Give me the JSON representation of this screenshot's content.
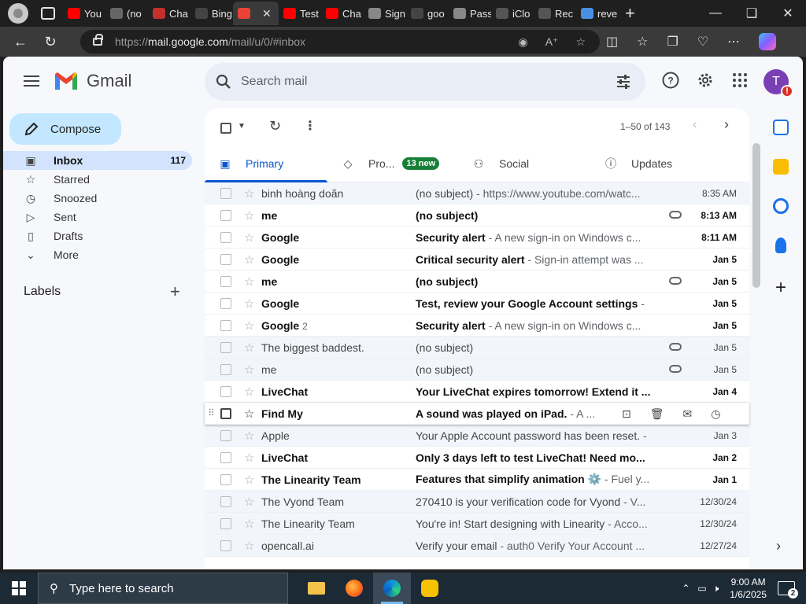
{
  "browser": {
    "tabs": [
      {
        "label": "You",
        "icon": "youtube-icon",
        "color": "#ff0000"
      },
      {
        "label": "(no",
        "icon": "gmail-icon",
        "color": "#666666"
      },
      {
        "label": "Cha",
        "icon": "youtube-icon",
        "color": "#c4302b"
      },
      {
        "label": "Bing",
        "icon": "search-icon",
        "color": "#444444"
      },
      {
        "label": "",
        "icon": "gmail-icon",
        "color": "#ea4335",
        "active": true
      },
      {
        "label": "Test",
        "icon": "youtube-icon",
        "color": "#ff0000"
      },
      {
        "label": "Cha",
        "icon": "youtube-icon",
        "color": "#ff0000"
      },
      {
        "label": "Sign",
        "icon": "google-icon",
        "color": "#888888"
      },
      {
        "label": "goo",
        "icon": "search-icon",
        "color": "#444444"
      },
      {
        "label": "Pass",
        "icon": "google-icon",
        "color": "#888888"
      },
      {
        "label": "iClo",
        "icon": "apple-icon",
        "color": "#555555"
      },
      {
        "label": "Rec",
        "icon": "apple-icon",
        "color": "#555555"
      },
      {
        "label": "reve",
        "icon": "search-icon",
        "color": "#4a90e2"
      }
    ],
    "url_prefix": "https://",
    "url_host": "mail.google.com",
    "url_path": "/mail/u/0/#inbox"
  },
  "gmail": {
    "logo_text": "Gmail",
    "search_placeholder": "Search mail",
    "avatar_letter": "T",
    "compose_label": "Compose",
    "nav": [
      {
        "label": "Inbox",
        "icon": "inbox-icon",
        "count": "117",
        "active": true
      },
      {
        "label": "Starred",
        "icon": "star-icon"
      },
      {
        "label": "Snoozed",
        "icon": "clock-icon"
      },
      {
        "label": "Sent",
        "icon": "send-icon"
      },
      {
        "label": "Drafts",
        "icon": "draft-icon"
      },
      {
        "label": "More",
        "icon": "chevron-down-icon"
      }
    ],
    "labels_title": "Labels",
    "pager": "1–50 of 143",
    "tabs": [
      {
        "label": "Primary",
        "icon": "inbox-icon",
        "active": true
      },
      {
        "label": "Pro...",
        "icon": "tag-icon",
        "badge": "13 new"
      },
      {
        "label": "Social",
        "icon": "people-icon"
      },
      {
        "label": "Updates",
        "icon": "info-icon"
      }
    ],
    "emails": [
      {
        "sender": "binh hoàng doãn",
        "subject": "(no subject)",
        "snippet": " - https://www.youtube.com/watc...",
        "date": "8:35 AM",
        "read": true
      },
      {
        "sender": "me",
        "subject": "(no subject)",
        "snippet": "",
        "date": "8:13 AM",
        "read": false,
        "attachment": true
      },
      {
        "sender": "Google",
        "subject": "Security alert",
        "snippet": " - A new sign-in on Windows c...",
        "date": "8:11 AM",
        "read": false
      },
      {
        "sender": "Google",
        "subject": "Critical security alert",
        "snippet": " - Sign-in attempt was ...",
        "date": "Jan 5",
        "read": false
      },
      {
        "sender": "me",
        "subject": "(no subject)",
        "snippet": "",
        "date": "Jan 5",
        "read": false,
        "attachment": true
      },
      {
        "sender": "Google",
        "subject": "Test, review your Google Account settings",
        "snippet": " -",
        "date": "Jan 5",
        "read": false
      },
      {
        "sender": "Google",
        "sender_count": "2",
        "subject": "Security alert",
        "snippet": " - A new sign-in on Windows c...",
        "date": "Jan 5",
        "read": false
      },
      {
        "sender": "The biggest baddest.",
        "subject": "(no subject)",
        "snippet": "",
        "date": "Jan 5",
        "read": true,
        "attachment": true
      },
      {
        "sender": "me",
        "subject": "(no subject)",
        "snippet": "",
        "date": "Jan 5",
        "read": true,
        "attachment": true
      },
      {
        "sender": "LiveChat",
        "subject": "Your LiveChat expires tomorrow! Extend it ...",
        "snippet": "",
        "date": "Jan 4",
        "read": false
      },
      {
        "sender": "Find My",
        "subject": "A sound was played on iPad.",
        "snippet": " - A ...",
        "date": "",
        "read": false,
        "hover": true
      },
      {
        "sender": "Apple",
        "subject": "Your Apple Account password has been reset.",
        "snippet": " -",
        "date": "Jan 3",
        "read": true
      },
      {
        "sender": "LiveChat",
        "subject": "Only 3 days left to test LiveChat! Need mo...",
        "snippet": "",
        "date": "Jan 2",
        "read": false
      },
      {
        "sender": "The Linearity Team",
        "subject": "Features that simplify animation ⚙️",
        "snippet": " - Fuel y...",
        "date": "Jan 1",
        "read": false
      },
      {
        "sender": "The Vyond Team",
        "subject": "270410 is your verification code for Vyond",
        "snippet": " - V...",
        "date": "12/30/24",
        "read": true
      },
      {
        "sender": "The Linearity Team",
        "subject": "You're in! Start designing with Linearity",
        "snippet": " - Acco...",
        "date": "12/30/24",
        "read": true
      },
      {
        "sender": "opencall.ai",
        "subject": "Verify your email",
        "snippet": " - auth0 Verify Your Account ...",
        "date": "12/27/24",
        "read": true
      }
    ]
  },
  "taskbar": {
    "search_placeholder": "Type here to search",
    "time": "9:00 AM",
    "date": "1/6/2025",
    "notifications": "2"
  },
  "colors": {
    "compose_bg": "#c2e7ff",
    "active_nav_bg": "#d3e3fd",
    "primary_blue": "#0b57d0",
    "new_badge": "#188038",
    "avatar_bg": "#7b3fb5"
  }
}
